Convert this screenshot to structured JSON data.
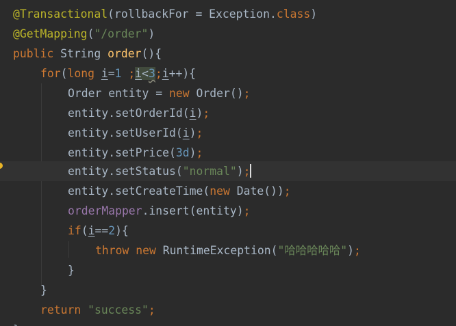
{
  "editor": {
    "lines": [
      {
        "parts": [
          {
            "t": "@Transactional",
            "c": "an"
          },
          {
            "t": "(rollbackFor = Exception.",
            "c": ""
          },
          {
            "t": "class",
            "c": "kw"
          },
          {
            "t": ")",
            "c": ""
          }
        ]
      },
      {
        "parts": [
          {
            "t": "@GetMapping",
            "c": "an"
          },
          {
            "t": "(",
            "c": ""
          },
          {
            "t": "\"/order\"",
            "c": "str"
          },
          {
            "t": ")",
            "c": ""
          }
        ]
      },
      {
        "parts": [
          {
            "t": "public ",
            "c": "kw"
          },
          {
            "t": "String ",
            "c": ""
          },
          {
            "t": "order",
            "c": "fn"
          },
          {
            "t": "(){",
            "c": ""
          }
        ]
      },
      {
        "parts": [
          {
            "t": "for",
            "c": "kw"
          },
          {
            "t": "(",
            "c": ""
          },
          {
            "t": "long ",
            "c": "kw"
          },
          {
            "t": "i",
            "c": "ul"
          },
          {
            "t": "=",
            "c": ""
          },
          {
            "t": "1 ",
            "c": "num"
          },
          {
            "t": ";",
            "c": "punc"
          },
          {
            "t": "i",
            "c": "ul hl"
          },
          {
            "t": "<",
            "c": "hl"
          },
          {
            "t": "3",
            "c": "num hl squig"
          },
          {
            "t": ";",
            "c": "punc"
          },
          {
            "t": "i",
            "c": "ul"
          },
          {
            "t": "++){",
            "c": ""
          }
        ]
      },
      {
        "parts": [
          {
            "t": "Order entity = ",
            "c": ""
          },
          {
            "t": "new ",
            "c": "kw"
          },
          {
            "t": "Order()",
            "c": ""
          },
          {
            "t": ";",
            "c": "punc"
          }
        ]
      },
      {
        "parts": [
          {
            "t": "entity.setOrderId(",
            "c": ""
          },
          {
            "t": "i",
            "c": "ul"
          },
          {
            "t": ")",
            "c": ""
          },
          {
            "t": ";",
            "c": "punc"
          }
        ]
      },
      {
        "parts": [
          {
            "t": "entity.setUserId(",
            "c": ""
          },
          {
            "t": "i",
            "c": "ul"
          },
          {
            "t": ")",
            "c": ""
          },
          {
            "t": ";",
            "c": "punc"
          }
        ]
      },
      {
        "parts": [
          {
            "t": "entity.setPrice(",
            "c": ""
          },
          {
            "t": "3d",
            "c": "num"
          },
          {
            "t": ")",
            "c": ""
          },
          {
            "t": ";",
            "c": "punc"
          }
        ]
      },
      {
        "parts": [
          {
            "t": "entity.setStatus(",
            "c": ""
          },
          {
            "t": "\"normal\"",
            "c": "str"
          },
          {
            "t": ")",
            "c": ""
          },
          {
            "t": ";",
            "c": "punc"
          }
        ]
      },
      {
        "parts": [
          {
            "t": "entity.setCreateTime(",
            "c": ""
          },
          {
            "t": "new ",
            "c": "kw"
          },
          {
            "t": "Date())",
            "c": ""
          },
          {
            "t": ";",
            "c": "punc"
          }
        ]
      },
      {
        "parts": [
          {
            "t": "orderMapper",
            "c": "fld"
          },
          {
            "t": ".insert(entity)",
            "c": ""
          },
          {
            "t": ";",
            "c": "punc"
          }
        ]
      },
      {
        "parts": [
          {
            "t": "if",
            "c": "kw"
          },
          {
            "t": "(",
            "c": ""
          },
          {
            "t": "i",
            "c": "ul"
          },
          {
            "t": "==",
            "c": ""
          },
          {
            "t": "2",
            "c": "num"
          },
          {
            "t": "){",
            "c": ""
          }
        ]
      },
      {
        "parts": [
          {
            "t": "throw ",
            "c": "kw"
          },
          {
            "t": "new ",
            "c": "kw"
          },
          {
            "t": "RuntimeException(",
            "c": ""
          },
          {
            "t": "\"哈哈哈哈哈\"",
            "c": "str"
          },
          {
            "t": ")",
            "c": ""
          },
          {
            "t": ";",
            "c": "punc"
          }
        ]
      },
      {
        "parts": [
          {
            "t": "}",
            "c": ""
          }
        ]
      },
      {
        "parts": [
          {
            "t": "}",
            "c": ""
          }
        ]
      },
      {
        "parts": [
          {
            "t": "return ",
            "c": "kw"
          },
          {
            "t": "\"success\"",
            "c": "str"
          },
          {
            "t": ";",
            "c": "punc"
          }
        ]
      },
      {
        "parts": [
          {
            "t": "}",
            "c": ""
          }
        ]
      }
    ]
  }
}
